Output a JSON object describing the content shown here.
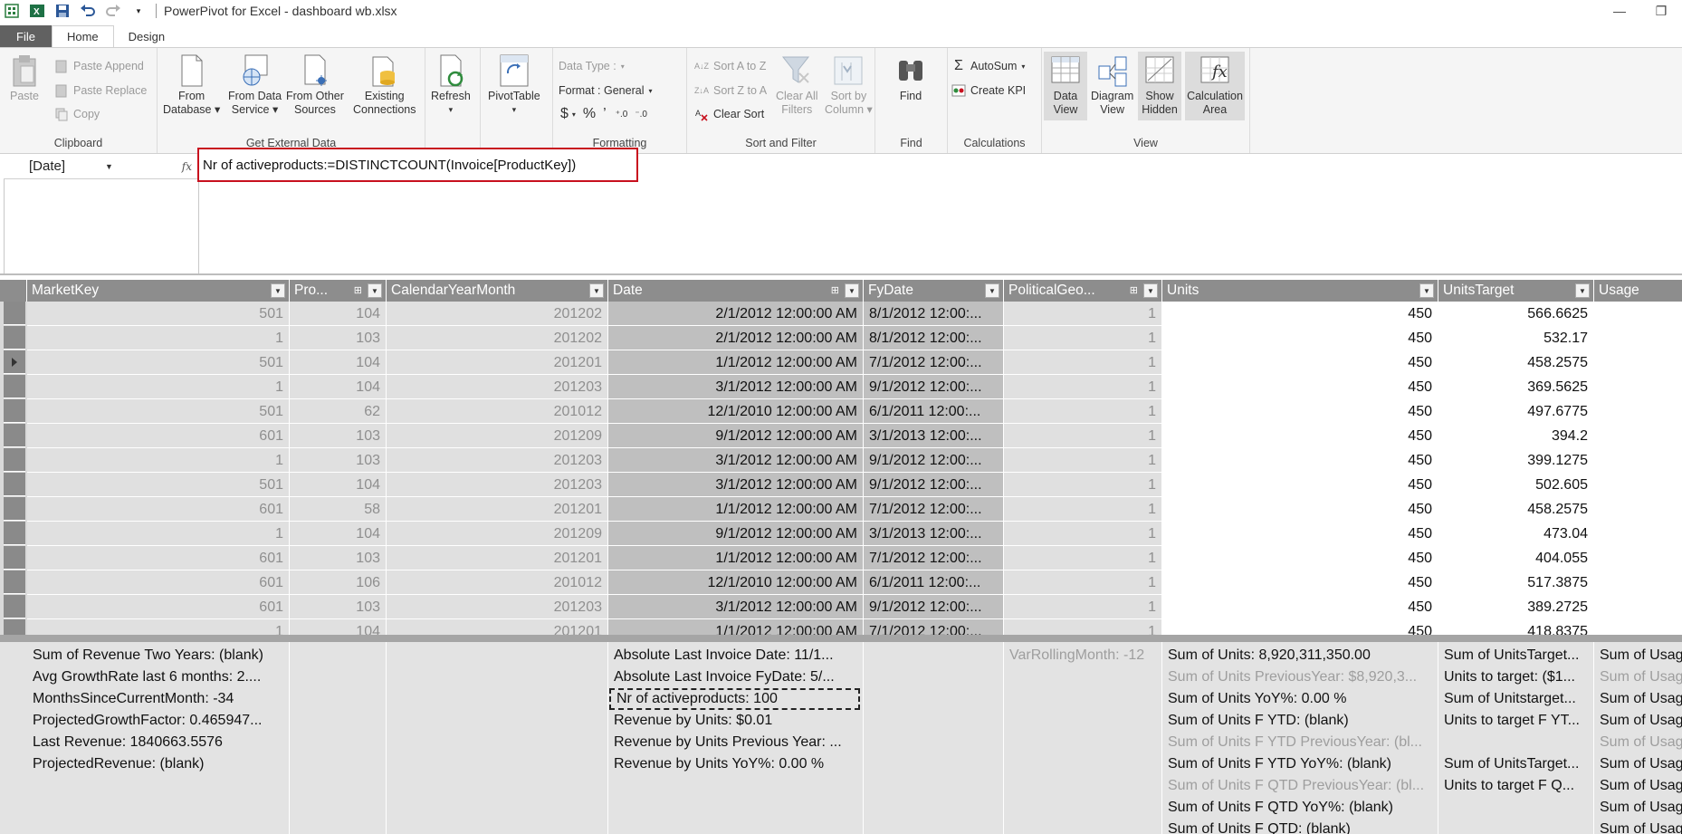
{
  "window": {
    "title": "PowerPivot for Excel - dashboard wb.xlsx"
  },
  "tabs": [
    {
      "label": "File"
    },
    {
      "label": "Home"
    },
    {
      "label": "Design"
    }
  ],
  "ribbon": {
    "clipboard": {
      "label": "Clipboard",
      "paste": "Paste",
      "paste_append": "Paste Append",
      "paste_replace": "Paste Replace",
      "copy": "Copy"
    },
    "external": {
      "label": "Get External Data",
      "from_database_1": "From",
      "from_database_2": "Database",
      "from_data_service_1": "From Data",
      "from_data_service_2": "Service",
      "from_other_1": "From Other",
      "from_other_2": "Sources",
      "existing_1": "Existing",
      "existing_2": "Connections"
    },
    "refresh": {
      "label": "Refresh"
    },
    "pivot": {
      "label": "PivotTable"
    },
    "formatting": {
      "label": "Formatting",
      "data_type": "Data Type :",
      "format": "Format : General",
      "currency": "$",
      "percent": "%",
      "comma": "’"
    },
    "sortfilter": {
      "label": "Sort and Filter",
      "sort_az": "Sort A to Z",
      "sort_za": "Sort Z to A",
      "clear_sort": "Clear Sort",
      "clear_filters_1": "Clear All",
      "clear_filters_2": "Filters",
      "sort_by_col_1": "Sort by",
      "sort_by_col_2": "Column"
    },
    "find": {
      "label": "Find",
      "button": "Find"
    },
    "calculations": {
      "label": "Calculations",
      "autosum": "AutoSum",
      "create_kpi": "Create KPI"
    },
    "view": {
      "label": "View",
      "data_view_1": "Data",
      "data_view_2": "View",
      "diagram_1": "Diagram",
      "diagram_2": "View",
      "show_hidden_1": "Show",
      "show_hidden_2": "Hidden",
      "calc_area_1": "Calculation",
      "calc_area_2": "Area"
    }
  },
  "formula_bar": {
    "name_box": "[Date]",
    "fx": "fx",
    "formula": "Nr of activeproducts:=DISTINCTCOUNT(Invoice[ProductKey])"
  },
  "grid": {
    "headers": [
      "MarketKey",
      "Pro...",
      "CalendarYearMonth",
      "Date",
      "FyDate",
      "PoliticalGeo...",
      "Units",
      "UnitsTarget",
      "Usage"
    ],
    "rows": [
      [
        "501",
        "104",
        "201202",
        "2/1/2012 12:00:00 AM",
        "8/1/2012 12:00:...",
        "1",
        "450",
        "566.6625"
      ],
      [
        "1",
        "103",
        "201202",
        "2/1/2012 12:00:00 AM",
        "8/1/2012 12:00:...",
        "1",
        "450",
        "532.17"
      ],
      [
        "501",
        "104",
        "201201",
        "1/1/2012 12:00:00 AM",
        "7/1/2012 12:00:...",
        "1",
        "450",
        "458.2575"
      ],
      [
        "1",
        "104",
        "201203",
        "3/1/2012 12:00:00 AM",
        "9/1/2012 12:00:...",
        "1",
        "450",
        "369.5625"
      ],
      [
        "501",
        "62",
        "201012",
        "12/1/2010 12:00:00 AM",
        "6/1/2011 12:00:...",
        "1",
        "450",
        "497.6775"
      ],
      [
        "601",
        "103",
        "201209",
        "9/1/2012 12:00:00 AM",
        "3/1/2013 12:00:...",
        "1",
        "450",
        "394.2"
      ],
      [
        "1",
        "103",
        "201203",
        "3/1/2012 12:00:00 AM",
        "9/1/2012 12:00:...",
        "1",
        "450",
        "399.1275"
      ],
      [
        "501",
        "104",
        "201203",
        "3/1/2012 12:00:00 AM",
        "9/1/2012 12:00:...",
        "1",
        "450",
        "502.605"
      ],
      [
        "601",
        "58",
        "201201",
        "1/1/2012 12:00:00 AM",
        "7/1/2012 12:00:...",
        "1",
        "450",
        "458.2575"
      ],
      [
        "1",
        "104",
        "201209",
        "9/1/2012 12:00:00 AM",
        "3/1/2013 12:00:...",
        "1",
        "450",
        "473.04"
      ],
      [
        "601",
        "103",
        "201201",
        "1/1/2012 12:00:00 AM",
        "7/1/2012 12:00:...",
        "1",
        "450",
        "404.055"
      ],
      [
        "601",
        "106",
        "201012",
        "12/1/2010 12:00:00 AM",
        "6/1/2011 12:00:...",
        "1",
        "450",
        "517.3875"
      ],
      [
        "601",
        "103",
        "201203",
        "3/1/2012 12:00:00 AM",
        "9/1/2012 12:00:...",
        "1",
        "450",
        "389.2725"
      ],
      [
        "1",
        "104",
        "201201",
        "1/1/2012 12:00:00 AM",
        "7/1/2012 12:00:...",
        "1",
        "450",
        "418.8375"
      ]
    ]
  },
  "calc_area": {
    "col_marketkey": [
      "Sum of Revenue Two Years: (blank)",
      "Avg GrowthRate last 6 months: 2....",
      "MonthsSinceCurrentMonth: -34",
      "ProjectedGrowthFactor: 0.465947...",
      "Last Revenue: 1840663.5576",
      "ProjectedRevenue: (blank)"
    ],
    "col_date": [
      "Absolute Last Invoice Date: 11/1...",
      "Absolute Last Invoice FyDate: 5/...",
      "Nr of activeproducts: 100",
      "Revenue by Units: $0.01",
      "Revenue by Units Previous Year: ...",
      "Revenue by Units YoY%: 0.00 %"
    ],
    "col_political": [
      "VarRollingMonth: -12"
    ],
    "col_units": [
      "Sum of Units: 8,920,311,350.00",
      "Sum of Units PreviousYear: $8,920,3...",
      "Sum of Units YoY%: 0.00 %",
      "Sum of Units F YTD: (blank)",
      "Sum of Units F YTD PreviousYear: (bl...",
      "Sum of Units F YTD YoY%: (blank)",
      "Sum of Units F QTD PreviousYear: (bl...",
      "Sum of Units F QTD YoY%: (blank)",
      "Sum of Units F QTD: (blank)"
    ],
    "col_unitstarget": [
      "Sum of UnitsTarget...",
      "Units to target: ($1...",
      "Sum of Unitstarget...",
      "Units to target F YT...",
      "",
      "Sum of UnitsTarget...",
      "Units to target F Q..."
    ],
    "col_usage": [
      "Sum of Usag",
      "Sum of Usag",
      "Sum of Usag",
      "Sum of Usag",
      "Sum of Usag",
      "Sum of Usag",
      "Sum of Usag",
      "Sum of Usag",
      "Sum of Usag"
    ]
  }
}
